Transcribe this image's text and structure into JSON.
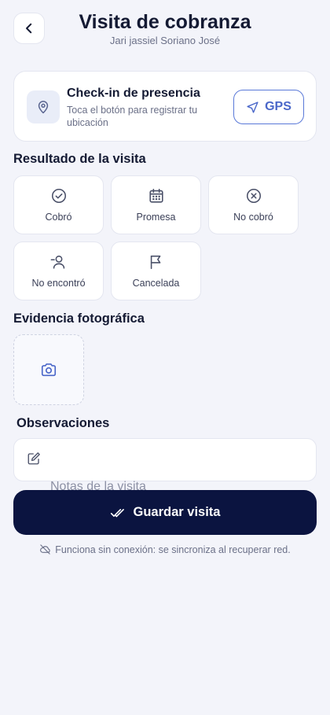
{
  "header": {
    "title": "Visita de cobranza",
    "subtitle": "Jari jassiel Soriano José",
    "back_icon": "chevron-left-icon"
  },
  "checkin": {
    "title": "Check-in de presencia",
    "description": "Toca el botón para registrar tu ubicación",
    "icon": "map-pin-icon",
    "gps_label": "GPS",
    "gps_icon": "navigation-arrow-icon"
  },
  "result": {
    "section_title": "Resultado de la visita",
    "options": [
      {
        "label": "Cobró",
        "icon": "check-circle-icon"
      },
      {
        "label": "Promesa",
        "icon": "calendar-icon"
      },
      {
        "label": "No cobró",
        "icon": "x-circle-icon"
      },
      {
        "label": "No encontró",
        "icon": "user-minus-icon"
      },
      {
        "label": "Cancelada",
        "icon": "flag-icon"
      }
    ]
  },
  "photo": {
    "section_title": "Evidencia fotográfica",
    "icon": "camera-icon"
  },
  "observations": {
    "section_title": "Observaciones",
    "placeholder": "Notas de la visita",
    "icon": "edit-icon"
  },
  "save": {
    "label": "Guardar visita",
    "icon": "double-check-icon"
  },
  "offline_note": "Funciona sin conexión: se sincroniza al recuperar red.",
  "colors": {
    "background": "#f3f4fa",
    "primary_dark": "#0b1440",
    "accent": "#4a67c9",
    "text": "#141a33",
    "muted": "#6b7088"
  }
}
